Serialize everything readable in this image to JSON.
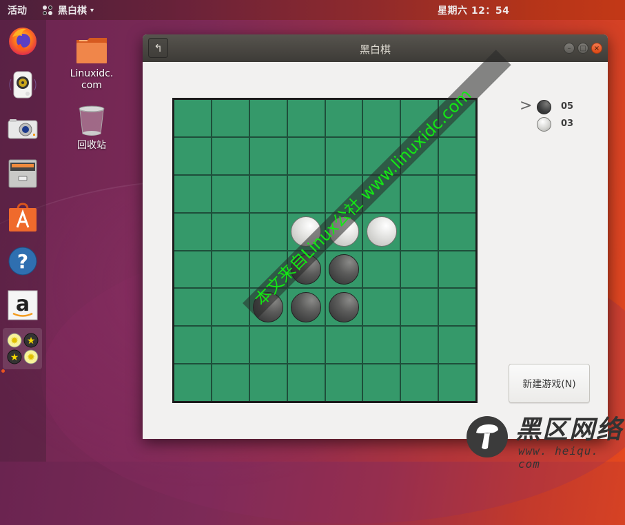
{
  "topbar": {
    "activities": "活动",
    "app_name": "黑白棋",
    "app_menu_caret": "▾",
    "clock": "星期六 12：54"
  },
  "dock": {
    "items": [
      {
        "name": "firefox",
        "icon": "firefox-icon"
      },
      {
        "name": "rhythmbox",
        "icon": "speaker-icon"
      },
      {
        "name": "shotwell",
        "icon": "camera-icon"
      },
      {
        "name": "files",
        "icon": "file-cabinet-icon"
      },
      {
        "name": "ubuntu-software",
        "icon": "shopping-bag-icon"
      },
      {
        "name": "help",
        "icon": "help-icon"
      },
      {
        "name": "amazon",
        "icon": "amazon-icon"
      },
      {
        "name": "reversi",
        "icon": "reversi-icon",
        "active": true
      }
    ]
  },
  "desktop": {
    "icons": [
      {
        "label": "Linuxidc.\ncom",
        "label_line1": "Linuxidc.",
        "label_line2": "com",
        "icon": "folder-icon"
      },
      {
        "label": "回收站",
        "icon": "trash-icon"
      }
    ]
  },
  "window": {
    "title": "黑白棋",
    "back_glyph": "↰",
    "minimize_glyph": "–",
    "maximize_glyph": "□",
    "close_glyph": "×"
  },
  "game": {
    "board_size": 8,
    "board_color": "#35996a",
    "pieces": [
      {
        "row": 3,
        "col": 3,
        "color": "white"
      },
      {
        "row": 3,
        "col": 4,
        "color": "white"
      },
      {
        "row": 3,
        "col": 5,
        "color": "white"
      },
      {
        "row": 4,
        "col": 3,
        "color": "black"
      },
      {
        "row": 4,
        "col": 4,
        "color": "black"
      },
      {
        "row": 5,
        "col": 2,
        "color": "black"
      },
      {
        "row": 5,
        "col": 3,
        "color": "black"
      },
      {
        "row": 5,
        "col": 4,
        "color": "black"
      }
    ],
    "current_turn": "black",
    "turn_indicator": ">",
    "scores": {
      "black": "05",
      "white": "03"
    },
    "new_game_label": "新建游戏(N)"
  },
  "watermarks": {
    "diagonal_text": "本文来自Linux公社 www.linuxidc.com",
    "logo_title": "黑区网络",
    "logo_url": "www. heiqu. com"
  }
}
